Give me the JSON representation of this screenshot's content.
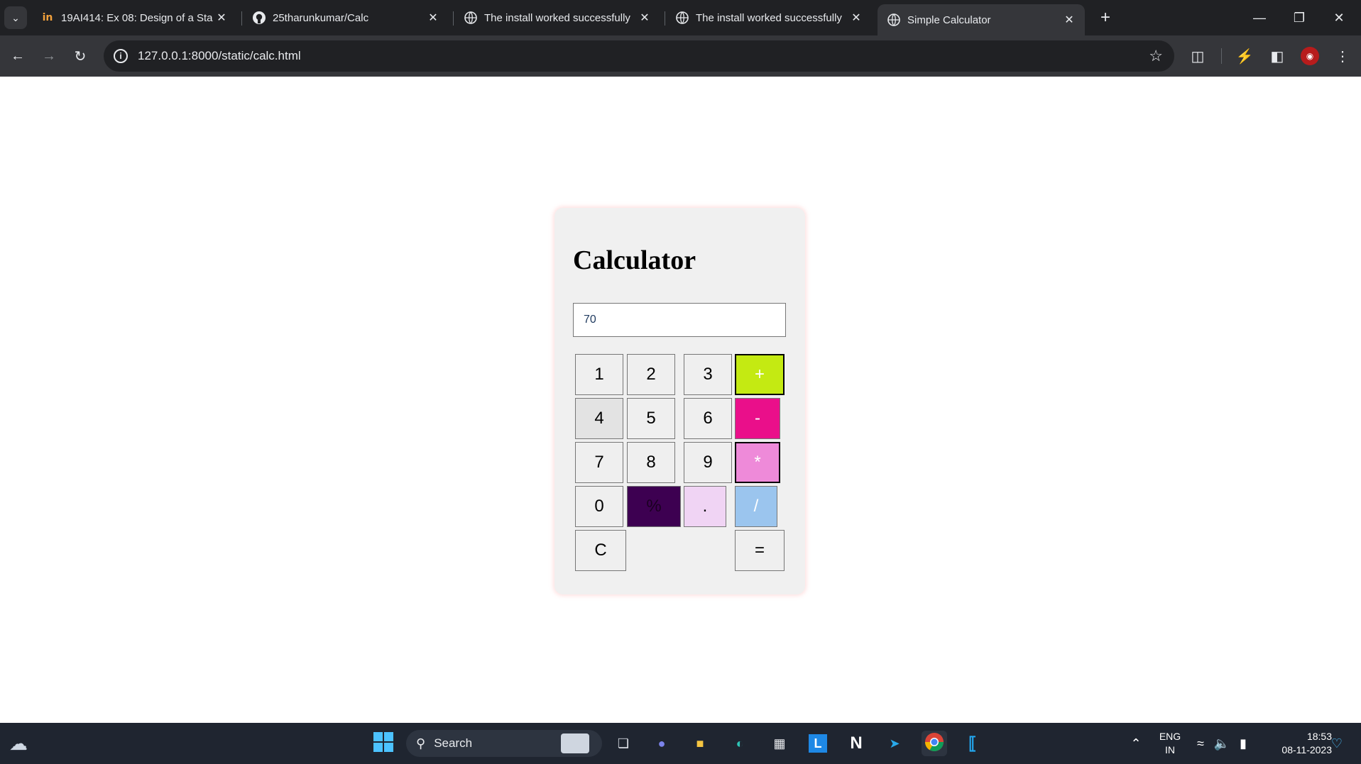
{
  "browser": {
    "tabs": [
      {
        "title": "19AI414: Ex 08: Design of a Sta",
        "favicon": "in-logo-icon",
        "active": false
      },
      {
        "title": "25tharunkumar/Calc",
        "favicon": "github-icon",
        "active": false
      },
      {
        "title": "The install worked successfully",
        "favicon": "globe-icon",
        "active": false
      },
      {
        "title": "The install worked successfully",
        "favicon": "globe-icon",
        "active": false
      },
      {
        "title": "Simple Calculator",
        "favicon": "globe-icon",
        "active": true
      }
    ],
    "address": "127.0.0.1:8000/static/calc.html"
  },
  "calculator": {
    "title": "Calculator",
    "display_value": "70",
    "keys": {
      "k1": "1",
      "k2": "2",
      "k3": "3",
      "plus": "+",
      "k4": "4",
      "k5": "5",
      "k6": "6",
      "minus": "-",
      "k7": "7",
      "k8": "8",
      "k9": "9",
      "multiply": "*",
      "k0": "0",
      "percent": "%",
      "dot": ".",
      "divide": "/",
      "clear": "C",
      "equals": "="
    },
    "colors": {
      "plus": "#c4ea12",
      "minus": "#ea0f8a",
      "multiply": "#ee8ad9",
      "percent": "#3d0051",
      "dot": "#f0d4f4",
      "divide": "#9bc5ee"
    }
  },
  "taskbar": {
    "search_label": "Search",
    "language_line1": "ENG",
    "language_line2": "IN",
    "time": "18:53",
    "date": "08-11-2023"
  }
}
